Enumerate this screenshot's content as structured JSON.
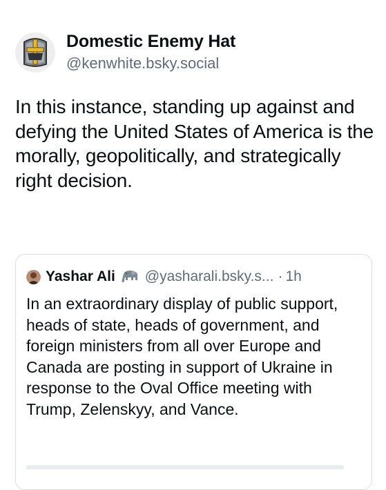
{
  "post": {
    "author": {
      "display_name": "Domestic Enemy Hat",
      "handle": "@kenwhite.bsky.social",
      "avatar_icon": "knight-helmet-icon"
    },
    "text": "In this instance, standing up against and defying the United States of America is the morally, geopolitically, and strategically right decision."
  },
  "quote": {
    "author": {
      "display_name": "Yashar Ali",
      "badge_icon": "elephant-icon",
      "handle": "@yasharali.bsky.s...",
      "separator": "·",
      "time": "1h"
    },
    "text": "In an extraordinary display of public support, heads of state, heads of government, and foreign ministers from all over Europe and Canada are posting in support of Ukraine in response to the Oval Office meeting with Trump, Zelenskyy, and Vance."
  },
  "colors": {
    "text_primary": "#0b0f14",
    "text_secondary": "#5f6b7a",
    "card_border": "#d9dee4",
    "helmet_gold": "#e8b92c",
    "helmet_steel": "#8a8f96"
  }
}
